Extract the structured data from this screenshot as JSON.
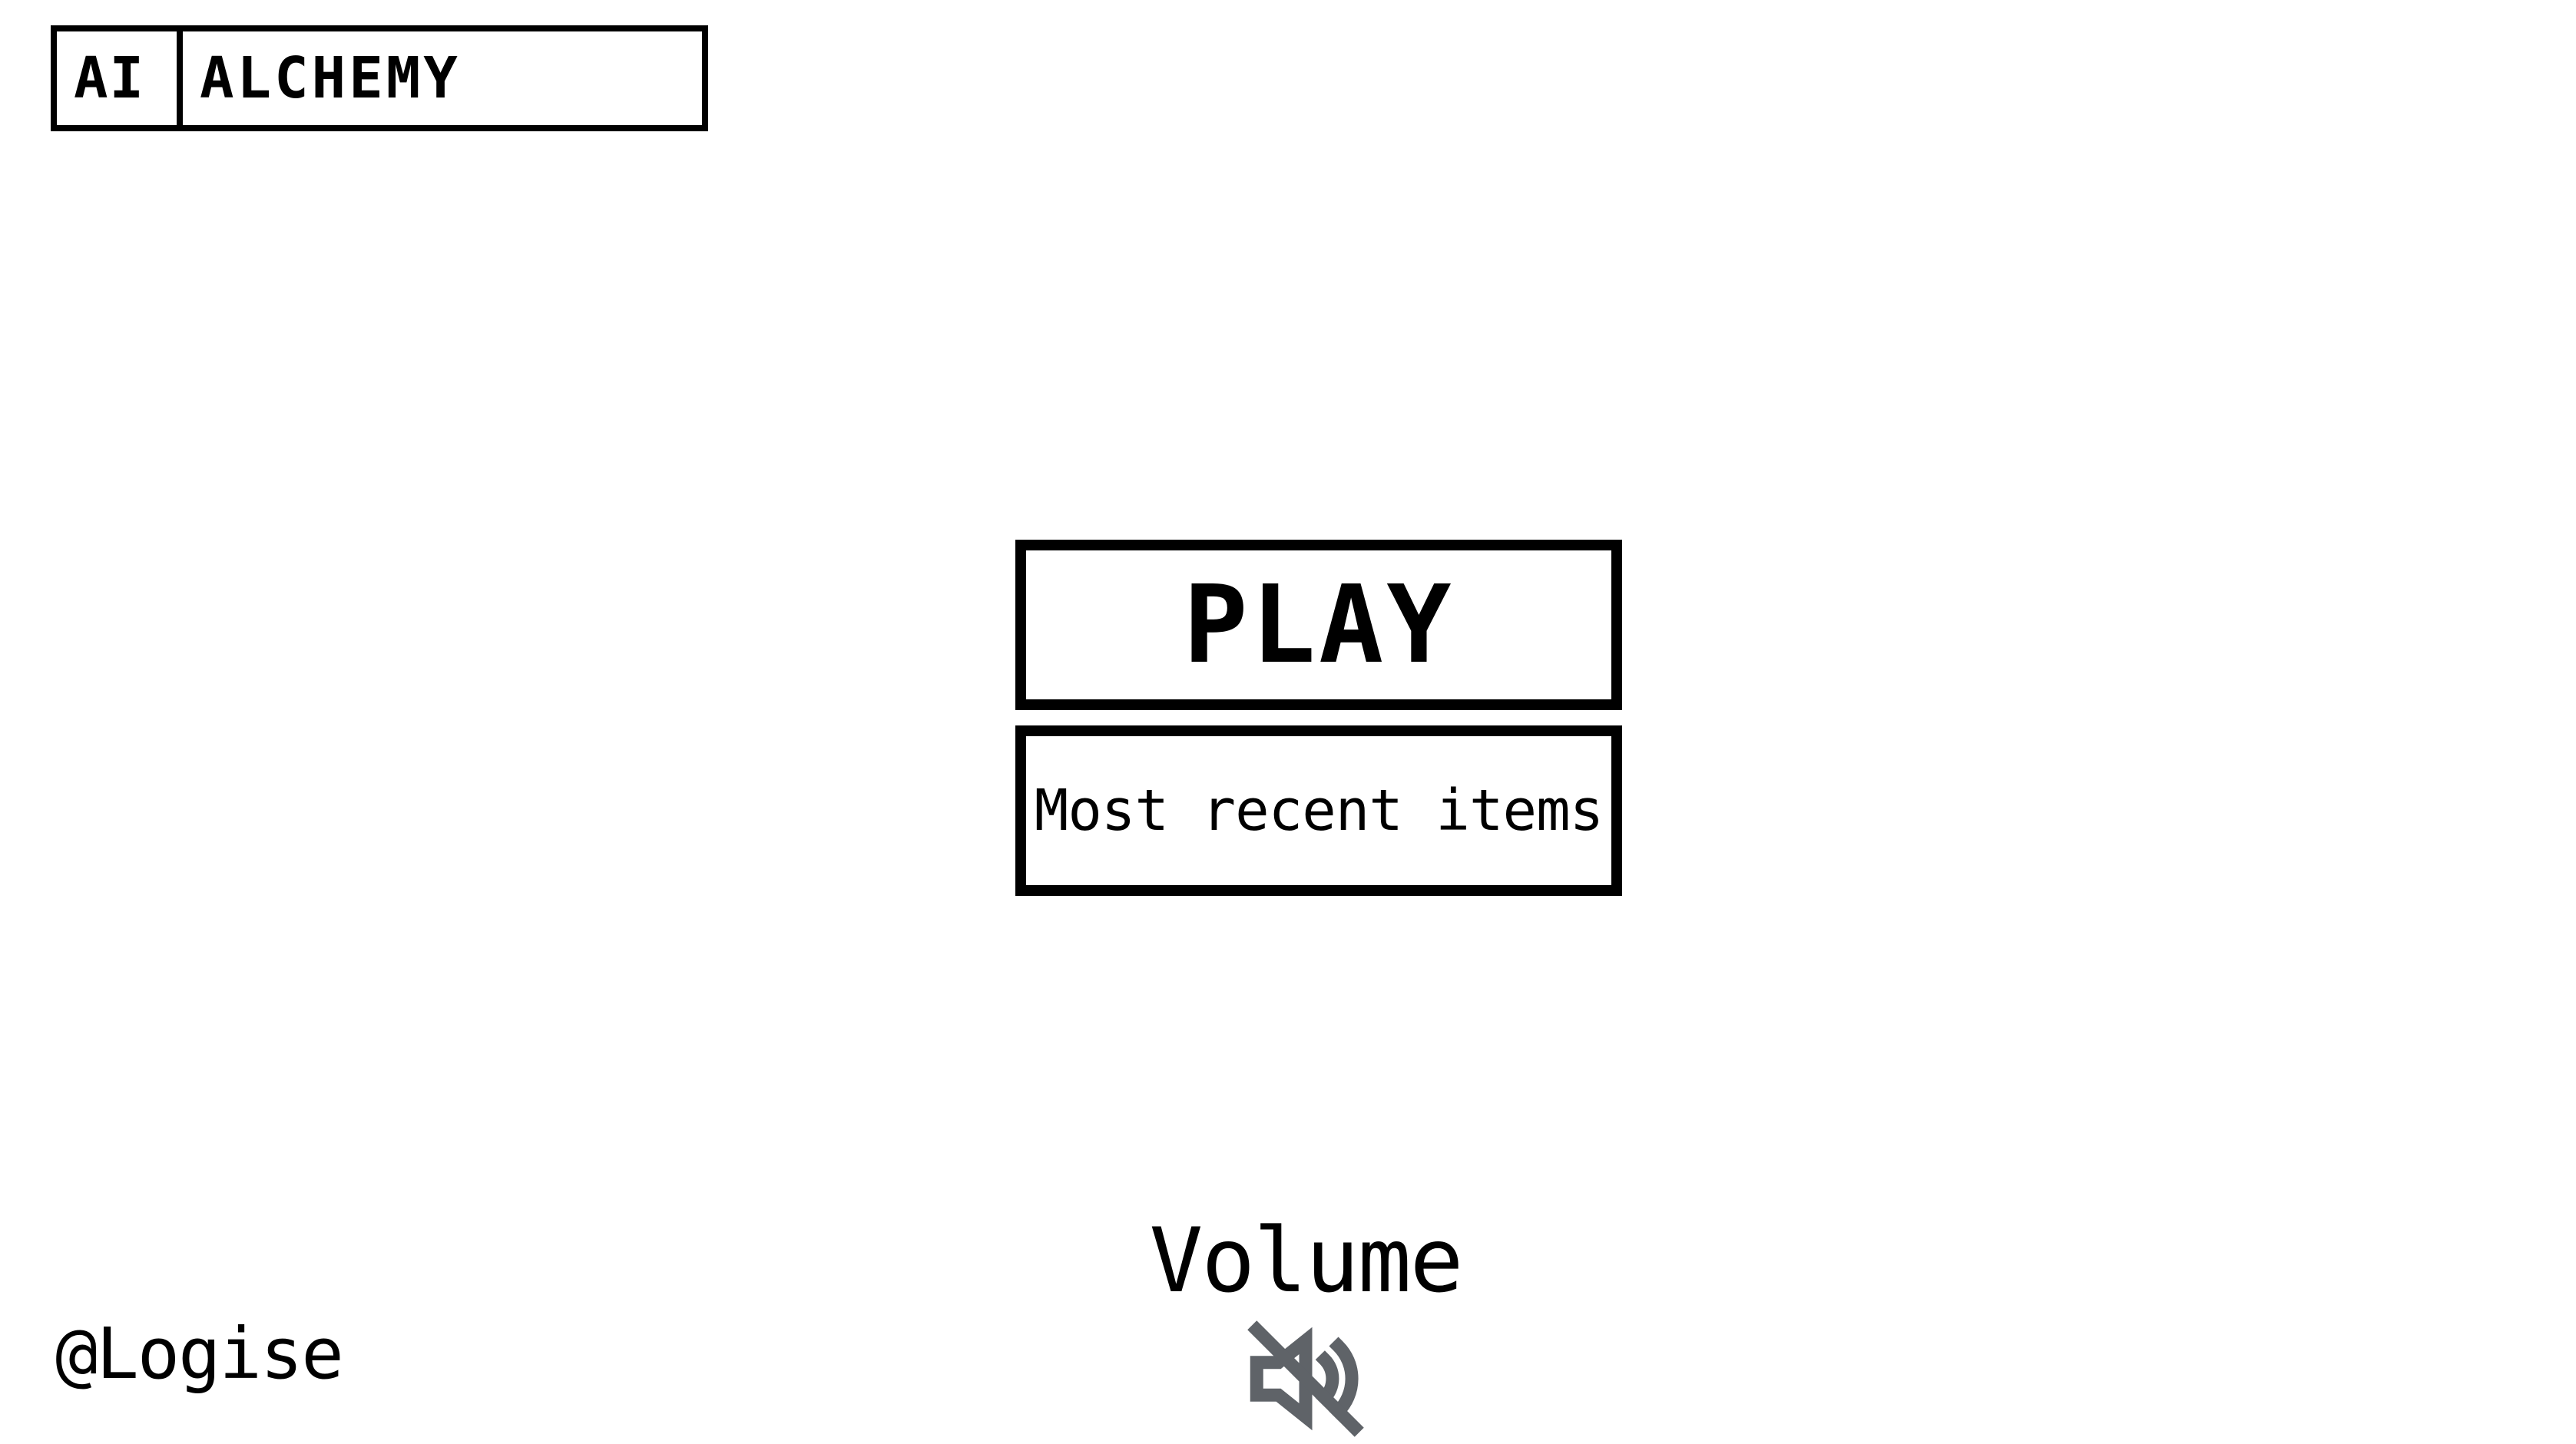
{
  "logo": {
    "short": "AI",
    "long": "ALCHEMY"
  },
  "menu": {
    "play_label": "PLAY",
    "recent_label": "Most recent items"
  },
  "volume": {
    "label": "Volume",
    "icon": "volume-muted-icon",
    "icon_color": "#5f6368"
  },
  "credit": {
    "text": "@Logise"
  }
}
